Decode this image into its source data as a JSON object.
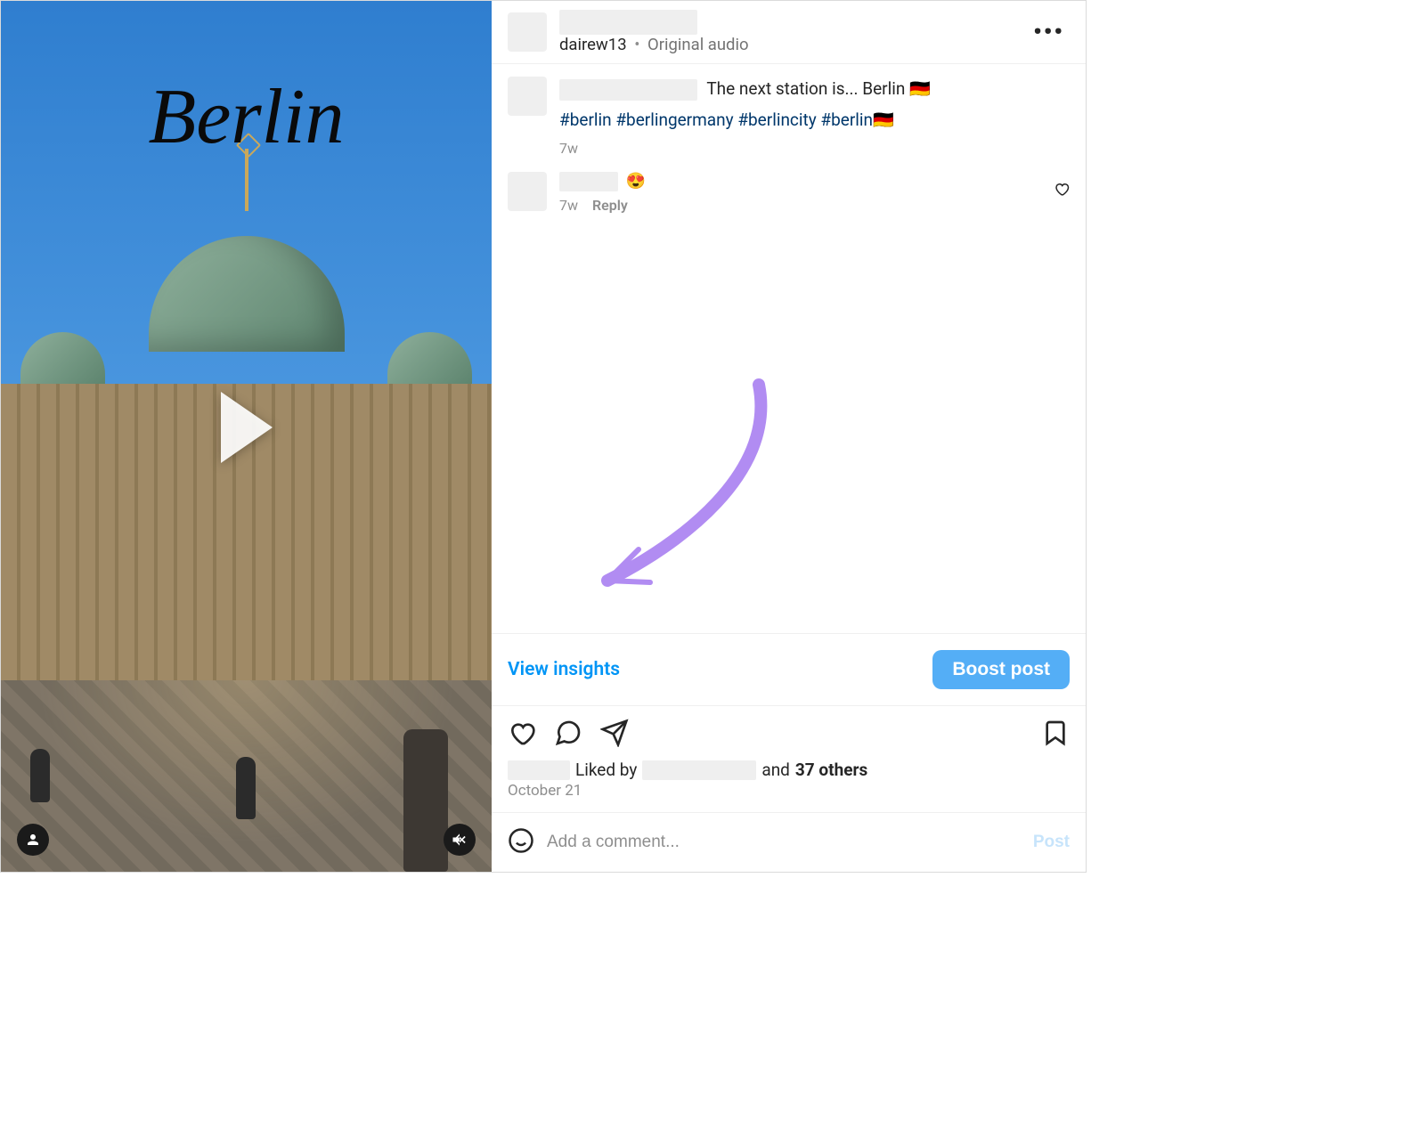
{
  "media": {
    "overlay_title": "Berlin"
  },
  "header": {
    "audio_user": "dairew13",
    "audio_label": "Original audio"
  },
  "caption": {
    "text": "The next station is... Berlin 🇩🇪",
    "hashtags": "#berlin #berlingermany #berlincity #berlin🇩🇪",
    "age": "7w"
  },
  "comments": [
    {
      "text": "😍",
      "age": "7w",
      "reply_label": "Reply"
    }
  ],
  "insights": {
    "view_label": "View insights",
    "boost_label": "Boost post"
  },
  "likes": {
    "prefix": "Liked by",
    "suffix_and": "and",
    "others": "37 others"
  },
  "date": "October 21",
  "input": {
    "placeholder": "Add a comment...",
    "post_label": "Post"
  }
}
